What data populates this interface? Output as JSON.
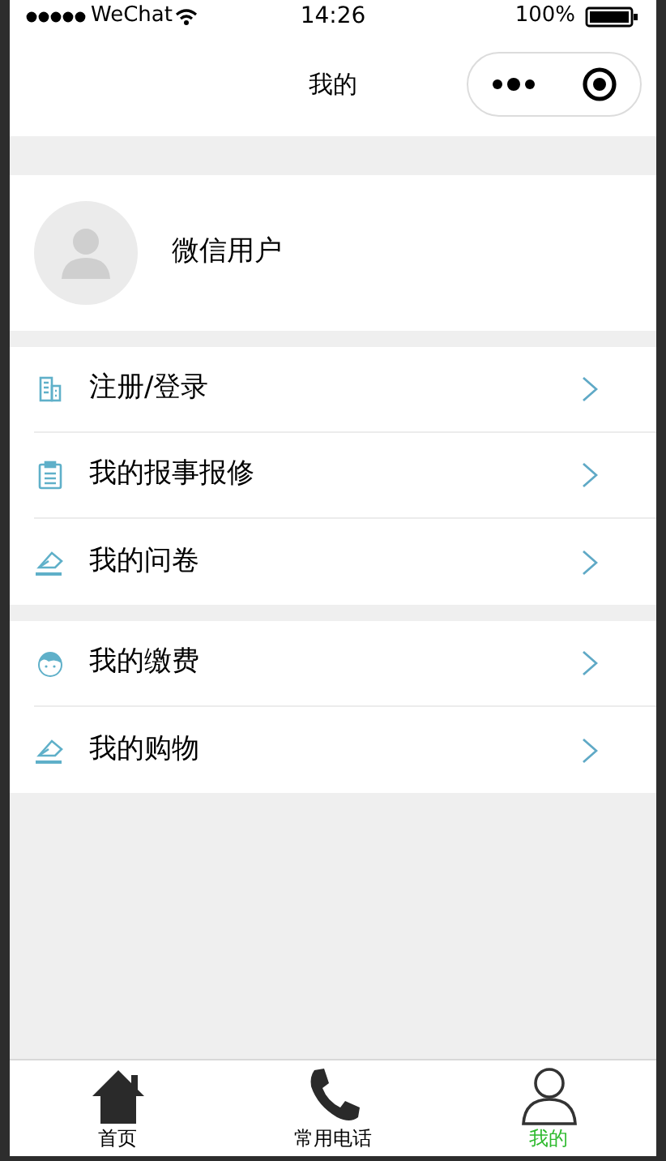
{
  "status_bar": {
    "carrier": "WeChat",
    "time": "14:26",
    "battery": "100%"
  },
  "nav": {
    "title": "我的"
  },
  "profile": {
    "name": "微信用户"
  },
  "menu_groups": [
    {
      "items": [
        {
          "label": "注册/登录",
          "kind": "building"
        },
        {
          "label": "我的报事报修",
          "kind": "clipboard"
        },
        {
          "label": "我的问卷",
          "kind": "eraser"
        }
      ]
    },
    {
      "items": [
        {
          "label": "我的缴费",
          "kind": "face"
        },
        {
          "label": "我的购物",
          "kind": "eraser"
        }
      ]
    }
  ],
  "tab_bar": [
    {
      "label": "首页",
      "kind": "home",
      "selected": false
    },
    {
      "label": "常用电话",
      "kind": "phone",
      "selected": false
    },
    {
      "label": "我的",
      "kind": "user",
      "selected": true
    }
  ]
}
